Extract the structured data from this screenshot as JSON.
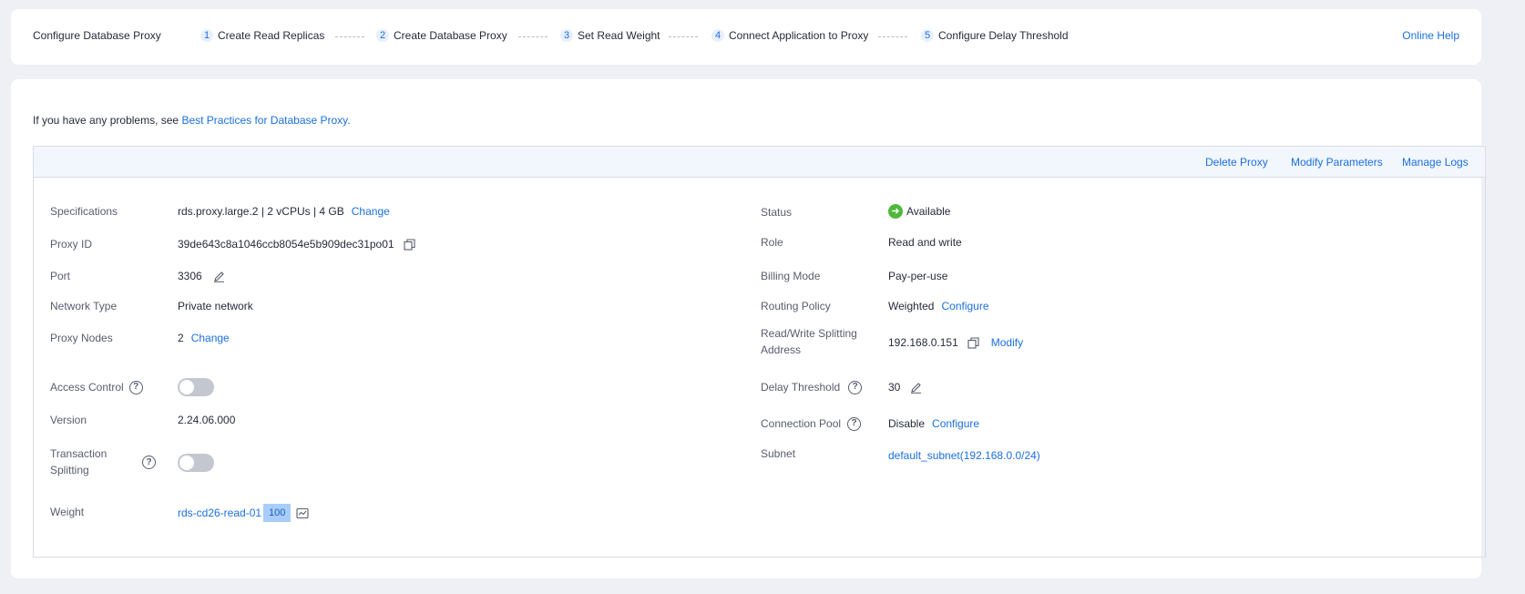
{
  "stepbar": {
    "title": "Configure Database Proxy",
    "steps": [
      {
        "num": "1",
        "label": "Create Read Replicas"
      },
      {
        "num": "2",
        "label": "Create Database Proxy"
      },
      {
        "num": "3",
        "label": "Set Read Weight"
      },
      {
        "num": "4",
        "label": "Connect Application to Proxy"
      },
      {
        "num": "5",
        "label": "Configure Delay Threshold"
      }
    ],
    "help": "Online Help"
  },
  "tip": {
    "text": "If you have any problems, see ",
    "link": "Best Practices for Database Proxy."
  },
  "actions": {
    "delete": "Delete Proxy",
    "modify": "Modify Parameters",
    "logs": "Manage Logs"
  },
  "left": {
    "spec_label": "Specifications",
    "spec_value": "rds.proxy.large.2 | 2 vCPUs | 4 GB",
    "spec_change": "Change",
    "id_label": "Proxy ID",
    "id_value": "39de643c8a1046ccb8054e5b909dec31po01",
    "port_label": "Port",
    "port_value": "3306",
    "network_label": "Network Type",
    "network_value": "Private network",
    "nodes_label": "Proxy Nodes",
    "nodes_value": "2",
    "nodes_change": "Change",
    "access_label": "Access Control",
    "access_enabled": false,
    "version_label": "Version",
    "version_value": "2.24.06.000",
    "txn_label_1": "Transaction",
    "txn_label_2": "Splitting",
    "txn_enabled": false,
    "weight_label": "Weight",
    "weight_instance": "rds-cd26-read-01",
    "weight_value": "100"
  },
  "right": {
    "status_label": "Status",
    "status_value": "Available",
    "status_color": "#50b83c",
    "role_label": "Role",
    "role_value": "Read and write",
    "billing_label": "Billing Mode",
    "billing_value": "Pay-per-use",
    "routing_label": "Routing Policy",
    "routing_value": "Weighted",
    "routing_configure": "Configure",
    "rw_label_1": "Read/Write Splitting",
    "rw_label_2": "Address",
    "rw_value": "192.168.0.151",
    "rw_modify": "Modify",
    "delay_label": "Delay Threshold",
    "delay_value": "30",
    "pool_label": "Connection Pool",
    "pool_value": "Disable",
    "pool_configure": "Configure",
    "subnet_label": "Subnet",
    "subnet_value": "default_subnet(192.168.0.0/24)"
  },
  "icons": {
    "copy": "copy-icon",
    "edit": "edit-icon",
    "help": "help-icon",
    "chart": "monitor-chart-icon",
    "status": "check-circle-icon"
  },
  "colors": {
    "link": "#1b6fe0",
    "header_bg": "#f2f6fd",
    "toggle_off": "#c3c7cf"
  }
}
